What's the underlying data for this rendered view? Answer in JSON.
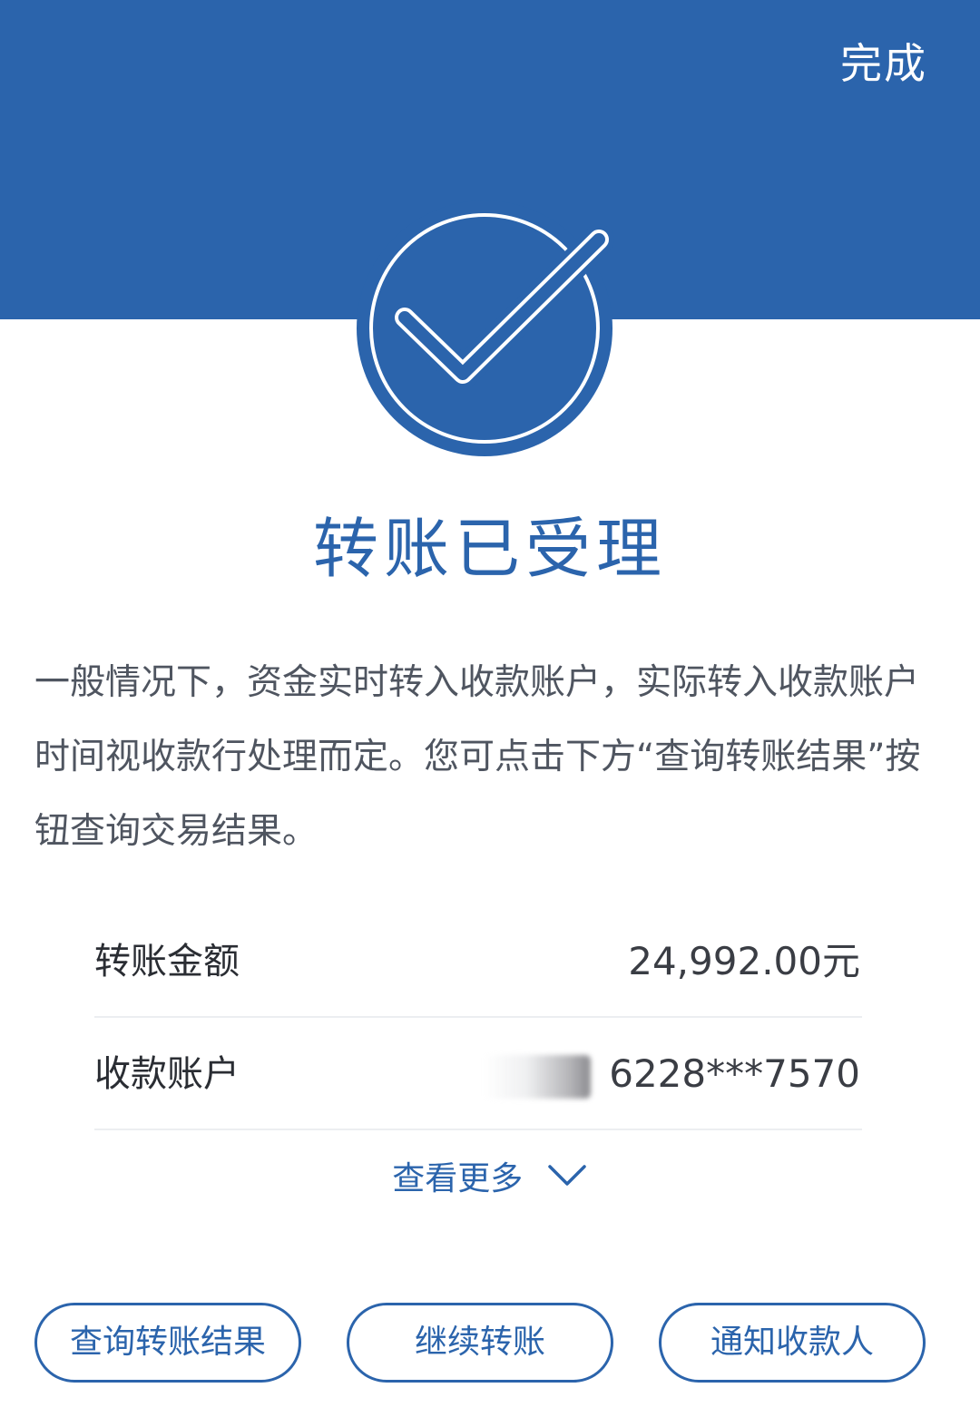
{
  "header": {
    "done_label": "完成",
    "accent_color": "#2b64ac"
  },
  "result": {
    "icon": "check-circle-icon",
    "title": "转账已受理",
    "description": "一般情况下，资金实时转入收款账户，实际转入收款账户时间视收款行处理而定。您可点击下方“查询转账结果”按钮查询交易结果。"
  },
  "details": {
    "amount_label": "转账金额",
    "amount_value": "24,992.00元",
    "account_label": "收款账户",
    "account_value": "6228***7570"
  },
  "see_more": {
    "label": "查看更多",
    "icon": "chevron-down-icon"
  },
  "actions": {
    "query_label": "查询转账结果",
    "continue_label": "继续转账",
    "notify_label": "通知收款人"
  }
}
